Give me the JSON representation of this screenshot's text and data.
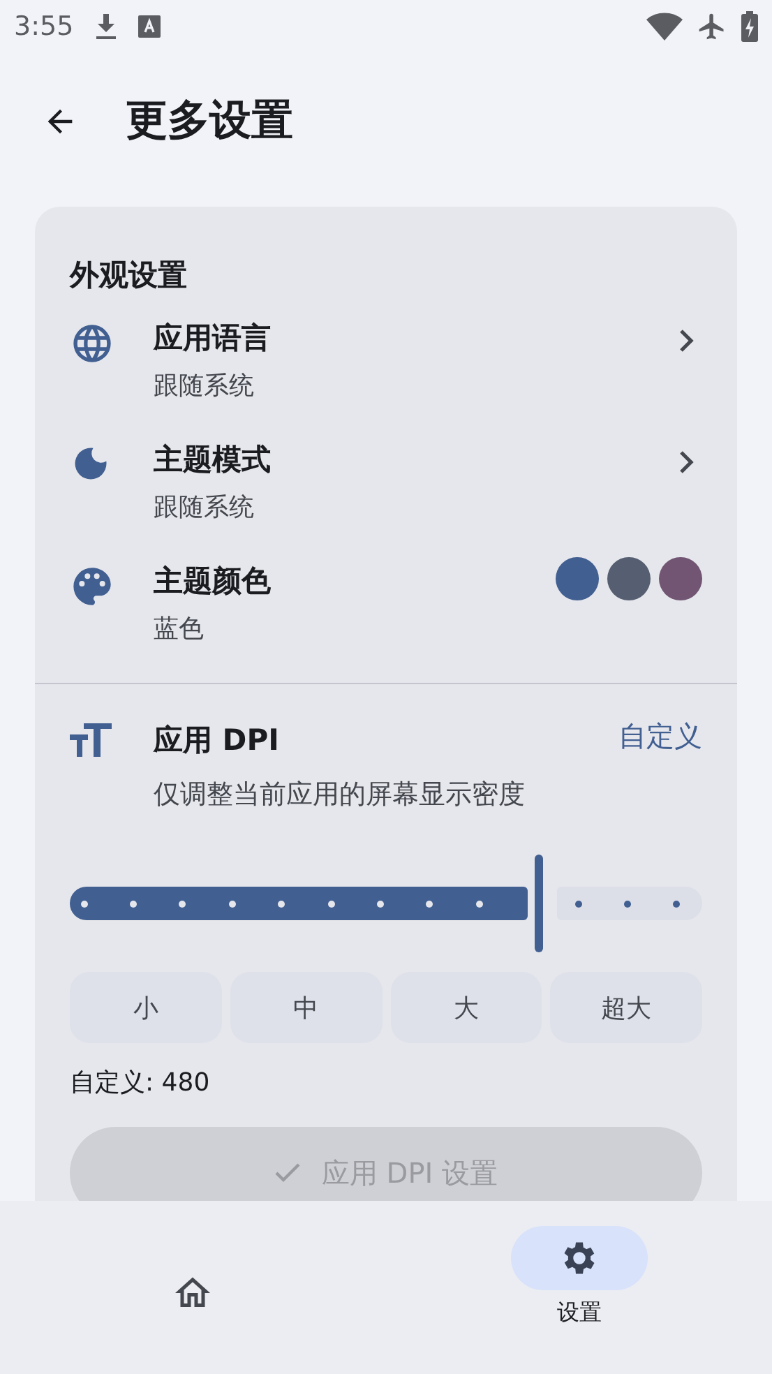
{
  "status_bar": {
    "time": "3:55"
  },
  "app_bar": {
    "title": "更多设置"
  },
  "appearance": {
    "title": "外观设置",
    "items": [
      {
        "kind": "link",
        "title": "应用语言",
        "subtitle": "跟随系统"
      },
      {
        "kind": "link",
        "title": "主题模式",
        "subtitle": "跟随系统"
      },
      {
        "kind": "colors",
        "title": "主题颜色",
        "subtitle": "蓝色",
        "swatches": [
          {
            "color": "#415f91"
          },
          {
            "color": "#565f71"
          },
          {
            "color": "#715573"
          }
        ]
      }
    ]
  },
  "dpi": {
    "title": "应用 DPI",
    "action": "自定义",
    "description": "仅调整当前应用的屏幕显示密度",
    "slider": {
      "level": 0.75
    },
    "presets": [
      {
        "label": "小",
        "selected": false
      },
      {
        "label": "中",
        "selected": false
      },
      {
        "label": "大",
        "selected": false
      },
      {
        "label": "超大",
        "selected": false
      }
    ],
    "custom_value": "自定义: 480",
    "apply_button": {
      "label": "应用 DPI 设置",
      "disabled": true
    }
  },
  "nav": [
    {
      "selected": false
    },
    {
      "label": "设置",
      "selected": true
    }
  ]
}
